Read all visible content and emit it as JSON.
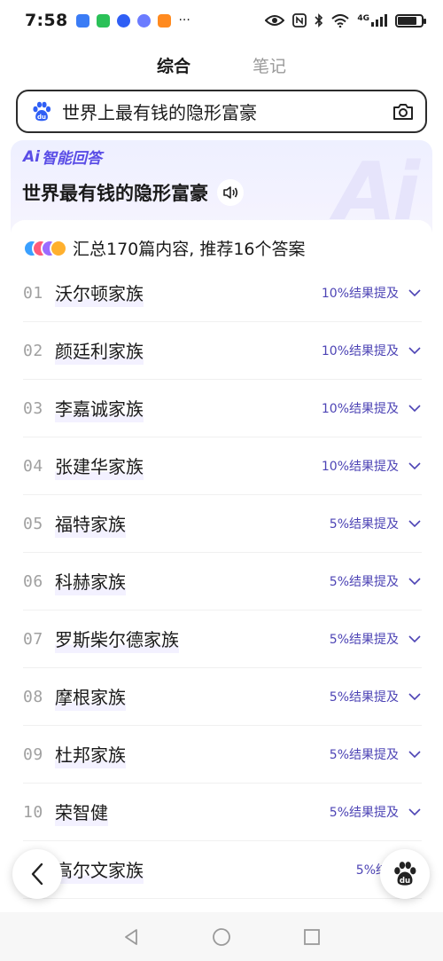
{
  "status": {
    "time": "7:58",
    "network": "4G"
  },
  "tabs": [
    {
      "label": "综合"
    },
    {
      "label": "笔记"
    }
  ],
  "search": {
    "query": "世界上最有钱的隐形富豪"
  },
  "ai": {
    "badge": "智能回答",
    "badge_prefix": "Ai",
    "watermark": "Ai",
    "title": "世界最有钱的隐形富豪"
  },
  "summary": "汇总170篇内容, 推荐16个答案",
  "results": [
    {
      "num": "01",
      "name": "沃尔顿家族",
      "pct": "10%结果提及"
    },
    {
      "num": "02",
      "name": "颜廷利家族",
      "pct": "10%结果提及"
    },
    {
      "num": "03",
      "name": "李嘉诚家族",
      "pct": "10%结果提及"
    },
    {
      "num": "04",
      "name": "张建华家族",
      "pct": "10%结果提及"
    },
    {
      "num": "05",
      "name": "福特家族",
      "pct": "5%结果提及"
    },
    {
      "num": "06",
      "name": "科赫家族",
      "pct": "5%结果提及"
    },
    {
      "num": "07",
      "name": "罗斯柴尔德家族",
      "pct": "5%结果提及"
    },
    {
      "num": "08",
      "name": "摩根家族",
      "pct": "5%结果提及"
    },
    {
      "num": "09",
      "name": "杜邦家族",
      "pct": "5%结果提及"
    },
    {
      "num": "10",
      "name": "荣智健",
      "pct": "5%结果提及"
    },
    {
      "num": "",
      "name": "高尔文家族",
      "pct": "5%结果提"
    }
  ],
  "colors": {
    "accent": "#5a4de6",
    "link": "#4d44b5",
    "baidu_blue": "#2f5ff5"
  }
}
